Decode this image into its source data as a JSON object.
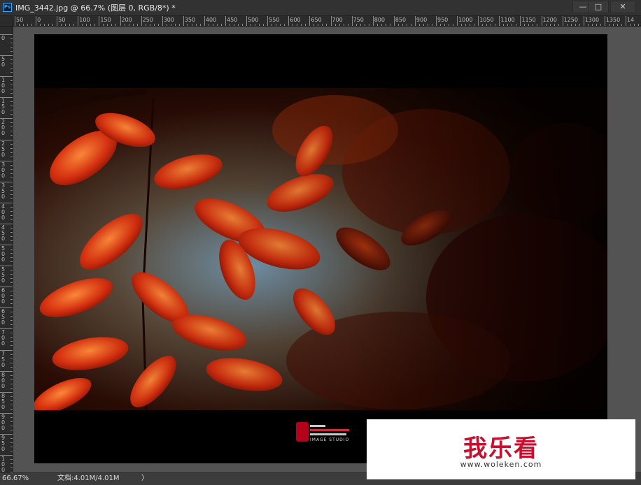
{
  "window": {
    "app_icon": "ps-icon",
    "app_icon_text": "Ps",
    "document_title": "IMG_3442.jpg @ 66.7% (图层 0, RGB/8*) *",
    "buttons": {
      "minimize": "—",
      "maximize": "□",
      "close": "✕"
    }
  },
  "ruler": {
    "horizontal_labels": [
      "50",
      "0",
      "50",
      "100",
      "150",
      "200",
      "250",
      "300",
      "350",
      "400",
      "450",
      "500",
      "550",
      "600",
      "650",
      "700",
      "750",
      "800",
      "850",
      "900",
      "950",
      "1000",
      "1050",
      "1100",
      "1150",
      "1200",
      "1250",
      "1300",
      "1350",
      "14"
    ],
    "vertical_labels": [
      "0",
      "50",
      "100",
      "150",
      "200",
      "250",
      "300",
      "350",
      "400",
      "450",
      "500",
      "550",
      "600",
      "650",
      "700",
      "750",
      "800",
      "850",
      "900",
      "950",
      "1000"
    ]
  },
  "canvas": {
    "watermark_text": "IMAGE STUDIO"
  },
  "status": {
    "zoom": "66.67%",
    "doc_size": "文档:4.01M/4.01M",
    "arrow": "〉"
  },
  "overlay": {
    "site_name": "我乐看",
    "site_url": "www.woleken.com"
  }
}
